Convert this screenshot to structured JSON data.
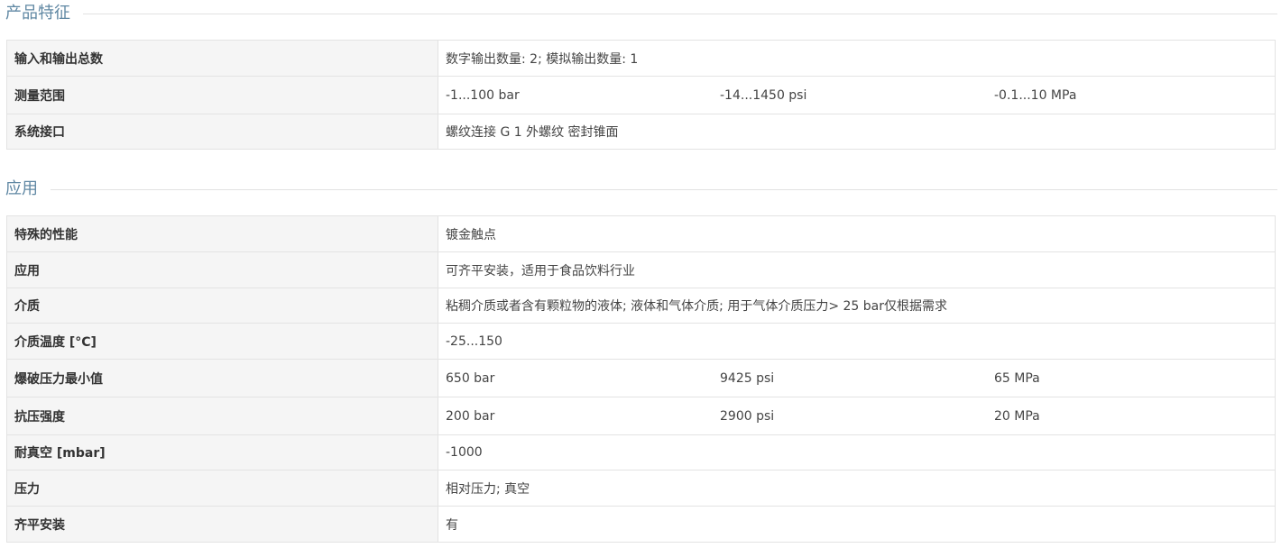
{
  "features": {
    "title": "产品特征",
    "rows": [
      {
        "label": "输入和输出总数",
        "values": [
          "数字输出数量: 2; 模拟输出数量: 1"
        ]
      },
      {
        "label": "测量范围",
        "values": [
          "-1...100 bar",
          "-14...1450 psi",
          "-0.1...10 MPa"
        ]
      },
      {
        "label": "系统接口",
        "values": [
          "螺纹连接 G 1 外螺纹 密封锥面"
        ]
      }
    ]
  },
  "application": {
    "title": "应用",
    "rows": [
      {
        "label": "特殊的性能",
        "values": [
          "镀金触点"
        ]
      },
      {
        "label": "应用",
        "values": [
          "可齐平安装，适用于食品饮料行业"
        ]
      },
      {
        "label": "介质",
        "values": [
          "粘稠介质或者含有颗粒物的液体; 液体和气体介质; 用于气体介质压力> 25 bar仅根据需求"
        ]
      },
      {
        "label": "介质温度 [°C]",
        "values": [
          "-25...150"
        ]
      },
      {
        "label": "爆破压力最小值",
        "values": [
          "650 bar",
          "9425 psi",
          "65 MPa"
        ]
      },
      {
        "label": "抗压强度",
        "values": [
          "200 bar",
          "2900 psi",
          "20 MPa"
        ]
      },
      {
        "label": "耐真空 [mbar]",
        "values": [
          "-1000"
        ]
      },
      {
        "label": "压力",
        "values": [
          "相对压力; 真空"
        ]
      },
      {
        "label": "齐平安装",
        "values": [
          "有"
        ]
      }
    ]
  }
}
